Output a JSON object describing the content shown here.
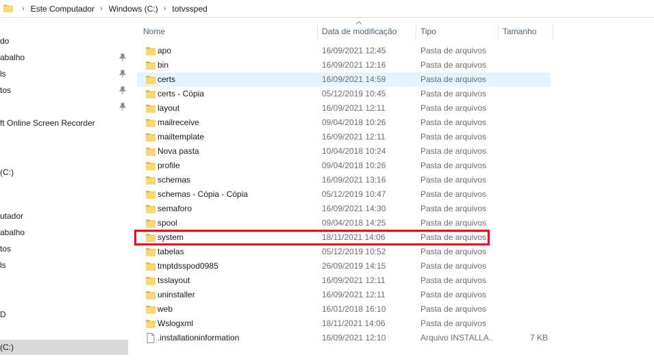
{
  "address": {
    "crumbs": [
      "Este Computador",
      "Windows (C:)",
      "totvssped"
    ]
  },
  "nav": {
    "items": [
      {
        "label": "do",
        "pinned": false,
        "selected": false
      },
      {
        "label": "abalho",
        "pinned": true,
        "selected": false
      },
      {
        "label": "ls",
        "pinned": true,
        "selected": false
      },
      {
        "label": "tos",
        "pinned": true,
        "selected": false
      },
      {
        "label": "",
        "pinned": true,
        "selected": false
      },
      {
        "label": "ft Online Screen Recorder",
        "pinned": false,
        "selected": false
      },
      {
        "label": "(C:)",
        "pinned": false,
        "selected": false
      },
      {
        "label": "utador",
        "pinned": false,
        "selected": false
      },
      {
        "label": "abalho",
        "pinned": false,
        "selected": false
      },
      {
        "label": "tos",
        "pinned": false,
        "selected": false
      },
      {
        "label": "ls",
        "pinned": false,
        "selected": false
      },
      {
        "label": "D",
        "pinned": false,
        "selected": false
      },
      {
        "label": "(C:)",
        "pinned": false,
        "selected": true
      }
    ]
  },
  "columns": {
    "name": "Nome",
    "date": "Data de modificação",
    "type": "Tipo",
    "size": "Tamanho"
  },
  "files": [
    {
      "name": "apo",
      "date": "16/09/2021 12:45",
      "type": "Pasta de arquivos",
      "size": "",
      "icon": "folder-icon"
    },
    {
      "name": "bin",
      "date": "16/09/2021 12:16",
      "type": "Pasta de arquivos",
      "size": "",
      "icon": "folder-icon"
    },
    {
      "name": "certs",
      "date": "16/09/2021 14:59",
      "type": "Pasta de arquivos",
      "size": "",
      "icon": "folder-icon",
      "hover": true
    },
    {
      "name": "certs - Cópia",
      "date": "05/12/2019 10:45",
      "type": "Pasta de arquivos",
      "size": "",
      "icon": "folder-icon"
    },
    {
      "name": "layout",
      "date": "16/09/2021 12:11",
      "type": "Pasta de arquivos",
      "size": "",
      "icon": "folder-icon"
    },
    {
      "name": "mailreceive",
      "date": "09/04/2018 10:26",
      "type": "Pasta de arquivos",
      "size": "",
      "icon": "folder-icon"
    },
    {
      "name": "mailtemplate",
      "date": "16/09/2021 12:11",
      "type": "Pasta de arquivos",
      "size": "",
      "icon": "folder-icon"
    },
    {
      "name": "Nova pasta",
      "date": "10/04/2018 10:24",
      "type": "Pasta de arquivos",
      "size": "",
      "icon": "folder-icon"
    },
    {
      "name": "profile",
      "date": "09/04/2018 10:26",
      "type": "Pasta de arquivos",
      "size": "",
      "icon": "folder-icon"
    },
    {
      "name": "schemas",
      "date": "16/09/2021 13:16",
      "type": "Pasta de arquivos",
      "size": "",
      "icon": "folder-icon"
    },
    {
      "name": "schemas - Cópia - Cópia",
      "date": "05/12/2019 10:47",
      "type": "Pasta de arquivos",
      "size": "",
      "icon": "folder-icon"
    },
    {
      "name": "semaforo",
      "date": "16/09/2021 14:30",
      "type": "Pasta de arquivos",
      "size": "",
      "icon": "folder-icon"
    },
    {
      "name": "spool",
      "date": "09/04/2018 14:25",
      "type": "Pasta de arquivos",
      "size": "",
      "icon": "folder-icon"
    },
    {
      "name": "system",
      "date": "18/11/2021 14:06",
      "type": "Pasta de arquivos",
      "size": "",
      "icon": "folder-icon",
      "highlighted": true
    },
    {
      "name": "tabelas",
      "date": "05/12/2019 10:52",
      "type": "Pasta de arquivos",
      "size": "",
      "icon": "folder-icon"
    },
    {
      "name": "tmptdsspod0985",
      "date": "26/09/2019 14:15",
      "type": "Pasta de arquivos",
      "size": "",
      "icon": "folder-icon"
    },
    {
      "name": "tsslayout",
      "date": "16/09/2021 12:11",
      "type": "Pasta de arquivos",
      "size": "",
      "icon": "folder-icon"
    },
    {
      "name": "uninstaller",
      "date": "16/09/2021 12:11",
      "type": "Pasta de arquivos",
      "size": "",
      "icon": "folder-icon"
    },
    {
      "name": "web",
      "date": "16/01/2018 16:10",
      "type": "Pasta de arquivos",
      "size": "",
      "icon": "folder-icon"
    },
    {
      "name": "Wslogxml",
      "date": "18/11/2021 14:06",
      "type": "Pasta de arquivos",
      "size": "",
      "icon": "folder-icon"
    },
    {
      "name": ".installationinformation",
      "date": "16/09/2021 12:10",
      "type": "Arquivo INSTALLA...",
      "size": "7 KB",
      "icon": "file-icon"
    }
  ],
  "colors": {
    "folder": "#f8d775",
    "folder_dark": "#e6b43c",
    "hover_row": "#e5f3ff",
    "highlight_border": "#e1111d",
    "header_text": "#4c607a"
  }
}
